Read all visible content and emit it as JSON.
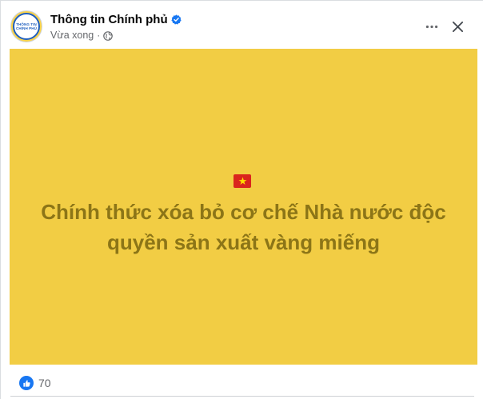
{
  "post": {
    "page_name": "Thông tin Chính phủ",
    "timestamp": "Vừa xong",
    "separator": "·",
    "privacy_icon": "globe-icon",
    "verified_icon": "verified-badge-icon",
    "avatar_text_top": "THÔNG TIN",
    "avatar_text_bottom": "CHÍNH PHỦ",
    "body_line1": "Chính thức xóa bỏ cơ chế Nhà nước độc",
    "body_line2": "quyền sản xuất vàng miếng",
    "background_color": "#f2cd44",
    "text_color": "#8c7517",
    "flag_icon": "vietnam-flag-icon"
  },
  "actions": {
    "more_icon": "more-options-icon",
    "close_icon": "close-icon"
  },
  "reactions": {
    "icon": "like-icon",
    "count": "70"
  }
}
